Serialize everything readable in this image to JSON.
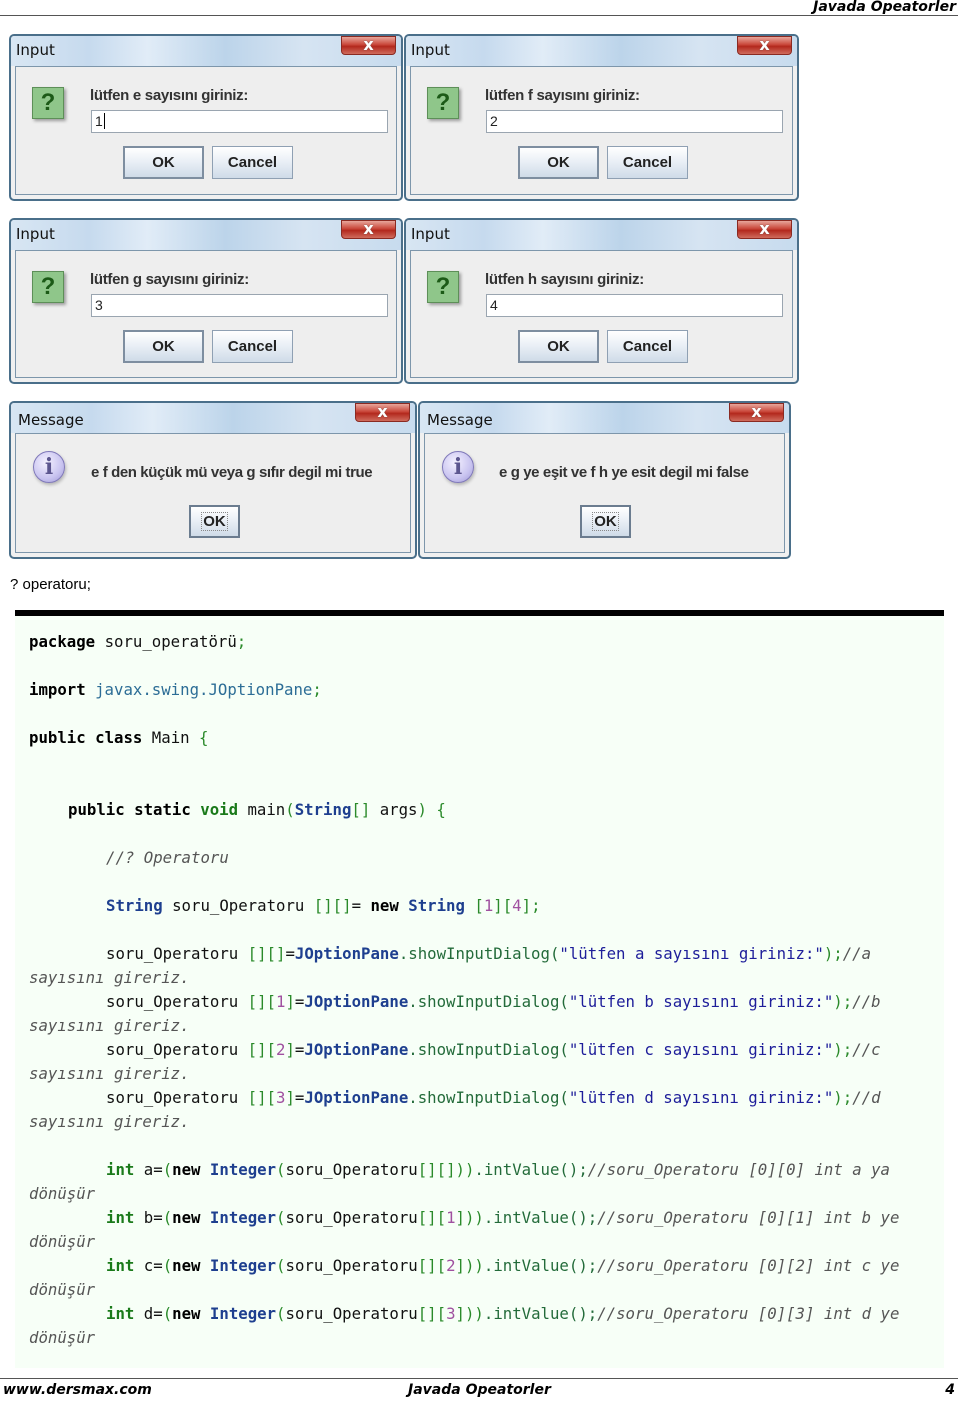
{
  "header": {
    "title": "Javada Opeatorler"
  },
  "input_dialogs": [
    {
      "title": "Input",
      "prompt": "lütfen e sayısını giriniz:",
      "value": "1",
      "ok": "OK",
      "cancel": "Cancel",
      "close": "x"
    },
    {
      "title": "Input",
      "prompt": "lütfen f sayısını giriniz:",
      "value": "2",
      "ok": "OK",
      "cancel": "Cancel",
      "close": "x"
    },
    {
      "title": "Input",
      "prompt": "lütfen g sayısını giriniz:",
      "value": "3",
      "ok": "OK",
      "cancel": "Cancel",
      "close": "x"
    },
    {
      "title": "Input",
      "prompt": "lütfen h sayısını giriniz:",
      "value": "4",
      "ok": "OK",
      "cancel": "Cancel",
      "close": "x"
    }
  ],
  "message_dialogs": [
    {
      "title": "Message",
      "message": "e f den küçük mü veya g sıfır degil mi true",
      "ok": "OK",
      "close": "x"
    },
    {
      "title": "Message",
      "message": "e g ye eşit ve f h ye esit degil mi false",
      "ok": "OK",
      "close": "x"
    }
  ],
  "icons": {
    "question": "?",
    "info": "i"
  },
  "section_label": "? operatoru;",
  "code": {
    "package_kw": "package",
    "package_name": " soru_operatörü",
    "semicolon": ";",
    "import_kw": "import",
    "import_name": " javax.swing.JOptionPane",
    "class_kw1": "public",
    "class_kw2": "class",
    "class_name": " Main ",
    "brace_open": "{",
    "main_public": "public",
    "main_static": "static",
    "main_void": "void",
    "main_name": " main",
    "paren_open": "(",
    "main_type": "String",
    "brackets": "[]",
    "main_args": " args",
    "paren_close": ")",
    "space": " ",
    "comment_operator": "//? Operatoru",
    "decl_type": "String",
    "decl_name": " soru_Operatoru ",
    "decl_brackets": "[][]",
    "decl_eq": "= ",
    "decl_new": "new",
    "decl_type2": " String ",
    "decl_b1": "[",
    "decl_n1": "1",
    "decl_b2": "][",
    "decl_n2": "4",
    "decl_b3": "];",
    "assign_lines": [
      {
        "var": "soru_Operatoru ",
        "idx": "",
        "jop": "JOptionPane",
        "method": ".showInputDialog(",
        "string": "\"lütfen a sayısını giriniz:\"",
        "end": ");",
        "comment": "//a",
        "cont": "sayısını gireriz."
      },
      {
        "var": "soru_Operatoru ",
        "idx": "1",
        "jop": "JOptionPane",
        "method": ".showInputDialog(",
        "string": "\"lütfen b sayısını giriniz:\"",
        "end": ");",
        "comment": "//b",
        "cont": "sayısını gireriz."
      },
      {
        "var": "soru_Operatoru ",
        "idx": "2",
        "jop": "JOptionPane",
        "method": ".showInputDialog(",
        "string": "\"lütfen c sayısını giriniz:\"",
        "end": ");",
        "comment": "//c",
        "cont": "sayısını gireriz."
      },
      {
        "var": "soru_Operatoru ",
        "idx": "3",
        "jop": "JOptionPane",
        "method": ".showInputDialog(",
        "string": "\"lütfen d sayısını giriniz:\"",
        "end": ");",
        "comment": "//d",
        "cont": "sayısını gireriz."
      }
    ],
    "int_lines": [
      {
        "kw": "int",
        "lhs": " a=",
        "new": "new",
        "type": " Integer",
        "arg": "soru_Operatoru",
        "idx": "",
        "tail": ".intValue();",
        "comment": "//soru_Operatoru [0][0] int a ya",
        "cont": "dönüşür"
      },
      {
        "kw": "int",
        "lhs": " b=",
        "new": "new",
        "type": " Integer",
        "arg": "soru_Operatoru",
        "idx": "1",
        "tail": ".intValue();",
        "comment": "//soru_Operatoru [0][1] int b ye",
        "cont": "dönüşür"
      },
      {
        "kw": "int",
        "lhs": " c=",
        "new": "new",
        "type": " Integer",
        "arg": "soru_Operatoru",
        "idx": "2",
        "tail": ".intValue();",
        "comment": "//soru_Operatoru [0][2] int c ye",
        "cont": "dönüşür"
      },
      {
        "kw": "int",
        "lhs": " d=",
        "new": "new",
        "type": " Integer",
        "arg": "soru_Operatoru",
        "idx": "3",
        "tail": ".intValue();",
        "comment": "//soru_Operatoru [0][3] int d ye",
        "cont": "dönüşür"
      }
    ]
  },
  "footer": {
    "website": "www.dersmax.com",
    "title": "Javada Opeatorler",
    "page_number": "4"
  }
}
